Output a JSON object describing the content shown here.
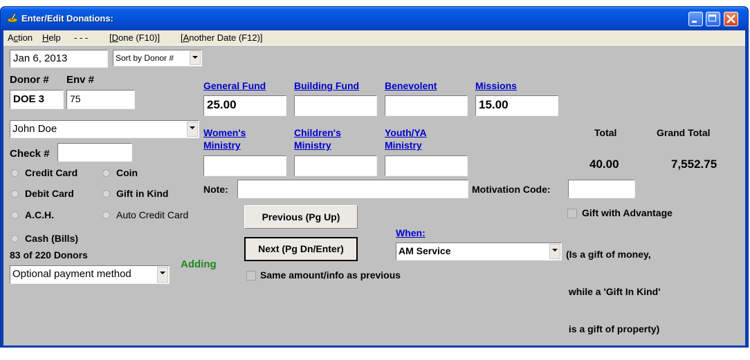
{
  "window": {
    "title": "Enter/Edit Donations:",
    "title_icon": "pen-ink-icon"
  },
  "menubar": {
    "items": [
      "Action",
      "Help",
      "- - -",
      "[Done (F10)]",
      "[Another Date (F12)]"
    ]
  },
  "date_field": {
    "value": "Jan 6, 2013"
  },
  "sort_select": {
    "value": "Sort by Donor #"
  },
  "donor": {
    "donor_label": "Donor #",
    "env_label": "Env #",
    "donor_value": "DOE  3",
    "env_value": "75",
    "name_value": "John Doe",
    "check_label": "Check #",
    "check_value": ""
  },
  "payment_methods": [
    {
      "label": "Credit Card",
      "selected": false
    },
    {
      "label": "Coin",
      "selected": false
    },
    {
      "label": "Debit Card",
      "selected": false
    },
    {
      "label": "Gift in Kind",
      "selected": false
    },
    {
      "label": "A.C.H.",
      "selected": false
    },
    {
      "label": "Auto Credit Card",
      "selected": false
    },
    {
      "label": "Cash (Bills)",
      "selected": false
    }
  ],
  "donor_count": "83 of 220 Donors",
  "status": {
    "text": "Adding",
    "color": "#1a8a1a"
  },
  "optional_payment": {
    "value": "Optional payment method"
  },
  "funds": [
    {
      "label": "General Fund",
      "value": "25.00"
    },
    {
      "label": "Building Fund",
      "value": ""
    },
    {
      "label": "Benevolent",
      "value": ""
    },
    {
      "label": "Missions",
      "value": "15.00"
    },
    {
      "label_line1": "Women's",
      "label_line2": "Ministry",
      "value": ""
    },
    {
      "label_line1": "Children's",
      "label_line2": "Ministry",
      "value": ""
    },
    {
      "label_line1": "Youth/YA",
      "label_line2": "Ministry",
      "value": ""
    }
  ],
  "totals": {
    "total_label": "Total",
    "grand_total_label": "Grand Total",
    "total_value": "40.00",
    "grand_total_value": "7,552.75"
  },
  "note": {
    "label": "Note:",
    "value": ""
  },
  "motivation": {
    "label": "Motivation Code:",
    "value": ""
  },
  "buttons": {
    "previous": "Previous (Pg Up)",
    "next": "Next (Pg Dn/Enter)"
  },
  "same_as_previous": {
    "label": "Same amount/info as previous",
    "checked": false
  },
  "when": {
    "label": "When:",
    "value": "AM Service"
  },
  "gift_advantage": {
    "label": "Gift with Advantage",
    "checked": false,
    "note_line1": "(Is a gift of money,",
    "note_line2": " while a 'Gift In Kind'",
    "note_line3": " is a gift of property)"
  },
  "colors": {
    "link": "#0000cc",
    "client_bg": "#c0c0c0",
    "titlebar": "#0553d8"
  }
}
